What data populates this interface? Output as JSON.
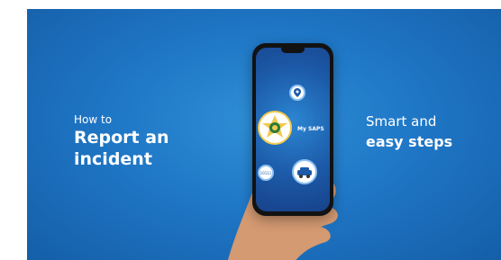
{
  "left": {
    "pre": "How to",
    "line1": "Report an",
    "line2": "incident"
  },
  "right": {
    "line1": "Smart and",
    "line2": "easy steps"
  },
  "phone": {
    "app_name": "My SAPS",
    "ten_label": "10111"
  },
  "colors": {
    "background": "#1f77c6",
    "accent_gold": "#f2c94c",
    "text": "#ffffff"
  },
  "icons": [
    "location-pin-icon",
    "saps-logo-icon",
    "emergency-number-icon",
    "police-car-icon"
  ]
}
